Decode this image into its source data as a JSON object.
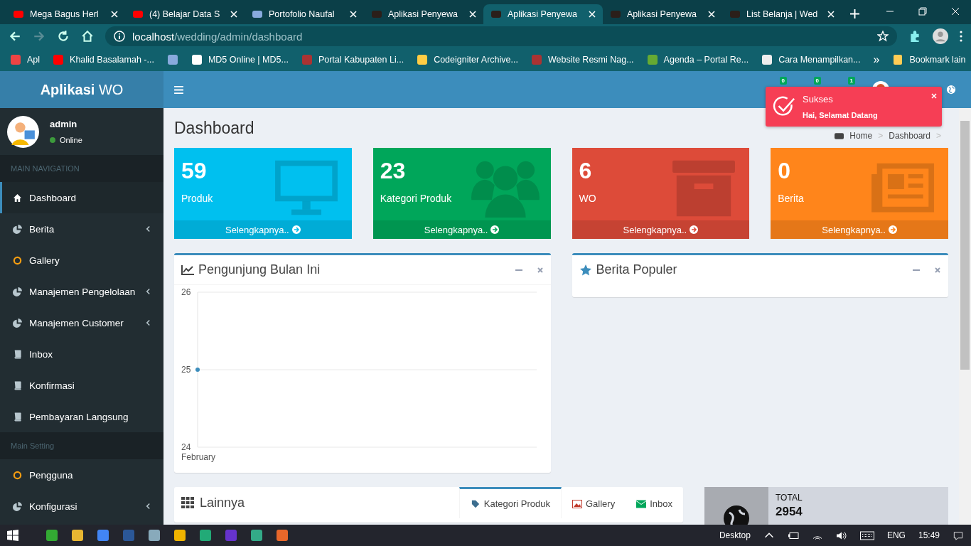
{
  "browser": {
    "tabs": [
      {
        "title": "Mega Bagus Herl",
        "kind": "youtube",
        "selected": false
      },
      {
        "title": "(4) Belajar Data S",
        "kind": "youtube",
        "selected": false
      },
      {
        "title": "Portofolio Naufal",
        "kind": "globe",
        "selected": false
      },
      {
        "title": "Aplikasi Penyewa",
        "kind": "wo",
        "selected": false
      },
      {
        "title": "Aplikasi Penyewa",
        "kind": "wo",
        "selected": true
      },
      {
        "title": "Aplikasi Penyewa",
        "kind": "wo",
        "selected": false
      },
      {
        "title": "List Belanja | Wed",
        "kind": "wo",
        "selected": false
      }
    ],
    "url_host": "localhost",
    "url_path": "/wedding/admin/dashboard",
    "bookmarks": [
      {
        "label": "Apl",
        "kind": "apps"
      },
      {
        "label": "Khalid Basalamah -...",
        "kind": "youtube"
      },
      {
        "kind": "globe"
      },
      {
        "label": "MD5 Online | MD5...",
        "kind": "lock"
      },
      {
        "label": "Portal Kabupaten Li...",
        "kind": "seal"
      },
      {
        "label": "Codeigniter Archive...",
        "kind": "note"
      },
      {
        "label": "Website Resmi Nag...",
        "kind": "seal"
      },
      {
        "label": "Agenda – Portal Re...",
        "kind": "shield"
      },
      {
        "label": "Cara Menampilkan...",
        "kind": "person"
      }
    ],
    "overflow_chevron": "»",
    "other_bookmarks": "Bookmark lain"
  },
  "app": {
    "logo": "**Aplikasi** WO",
    "header_badges": [
      "0",
      "0",
      "1"
    ],
    "user": {
      "name": "admin",
      "status": "Online"
    },
    "nav_sections": [
      {
        "header": "MAIN NAVIGATION",
        "items": [
          {
            "label": "Dashboard",
            "selected": true,
            "has_submenu": false
          },
          {
            "label": "Berita",
            "selected": false,
            "has_submenu": true
          },
          {
            "label": "Gallery",
            "selected": false,
            "has_submenu": false
          },
          {
            "label": "Manajemen Pengelolaan",
            "selected": false,
            "has_submenu": true
          },
          {
            "label": "Manajemen Customer",
            "selected": false,
            "has_submenu": true
          },
          {
            "label": "Inbox",
            "selected": false,
            "has_submenu": false
          },
          {
            "label": "Konfirmasi",
            "selected": false,
            "has_submenu": false
          },
          {
            "label": "Pembayaran Langsung",
            "selected": false,
            "has_submenu": false
          }
        ]
      },
      {
        "header": "Main Setting",
        "items": [
          {
            "label": "Pengguna",
            "selected": false,
            "has_submenu": false
          },
          {
            "label": "Konfigurasi",
            "selected": false,
            "has_submenu": true
          }
        ]
      }
    ],
    "page_title": "Dashboard",
    "breadcrumb": [
      "Home",
      "Dashboard"
    ],
    "breadcrumb_separator": ">",
    "stat_boxes": [
      {
        "value": "59",
        "label": "Produk",
        "link": "Selengkapnya..",
        "color": "#00c0ef"
      },
      {
        "value": "23",
        "label": "Kategori Produk",
        "link": "Selengkapnya..",
        "color": "#00a65a"
      },
      {
        "value": "6",
        "label": "WO",
        "link": "Selengkapnya..",
        "color": "#dd4b39"
      },
      {
        "value": "0",
        "label": "Berita",
        "link": "Selengkapnya..",
        "color": "#ff851b"
      }
    ],
    "visitors_box": {
      "title": "Pengunjung Bulan Ini",
      "chart_data": {
        "type": "line",
        "categories": [
          "February"
        ],
        "series": [
          {
            "color": "#3c8dbc",
            "marker": true,
            "values": [
              25
            ]
          }
        ],
        "ylim": [
          24,
          26
        ],
        "yticks": [
          24,
          25,
          26
        ]
      }
    },
    "popular_box": {
      "title": "Berita Populer"
    },
    "other_box": {
      "title": "Lainnya",
      "tabs": [
        {
          "label": "Kategori Produk",
          "selected": true
        },
        {
          "label": "Gallery",
          "selected": false
        },
        {
          "label": "Inbox",
          "selected": false
        }
      ]
    },
    "total_box": {
      "label": "TOTAL",
      "value": "2954"
    },
    "toast": {
      "title": "Sukses",
      "message": "Hai, Selamat Datang"
    }
  },
  "taskbar": {
    "desktop": "Desktop",
    "language": "ENG",
    "time": "15:49"
  }
}
